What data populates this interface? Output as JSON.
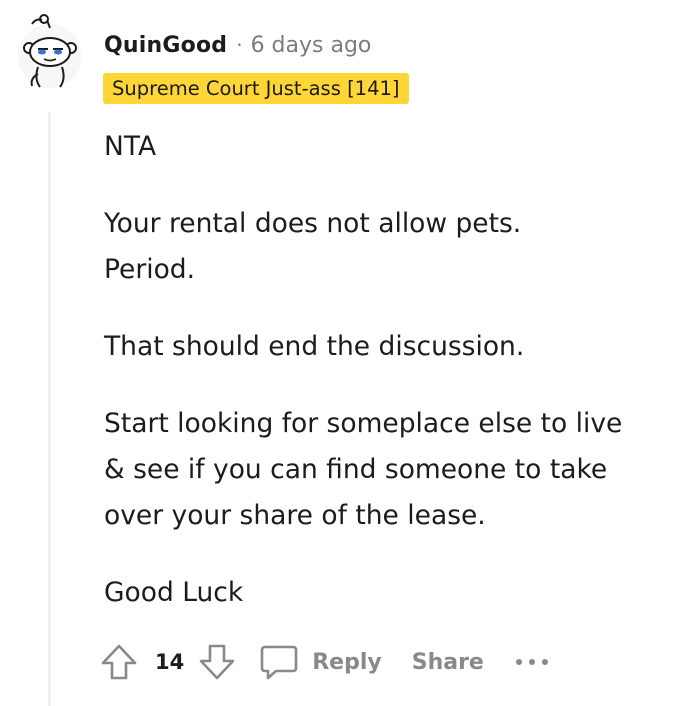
{
  "comment": {
    "author": "QuinGood",
    "separator": "·",
    "timestamp": "6 days ago",
    "flair": "Supreme Court Just-ass [141]",
    "paragraphs": [
      "NTA",
      "Your rental does not allow pets.\nPeriod.",
      "That should end the discussion.",
      "Start looking for someplace else to live\n& see if you can find someone to take\nover your share of the lease.",
      "Good Luck"
    ]
  },
  "actions": {
    "vote_count": "14",
    "reply_label": "Reply",
    "share_label": "Share",
    "icons": {
      "upvote": "upvote-arrow-icon",
      "downvote": "downvote-arrow-icon",
      "reply": "speech-bubble-icon",
      "more": "more-horizontal-icon"
    }
  },
  "colors": {
    "flair_background": "#ffd635",
    "muted_text": "#7c7c7c",
    "action_text": "#878a8c",
    "thread_line": "#edeff1"
  }
}
